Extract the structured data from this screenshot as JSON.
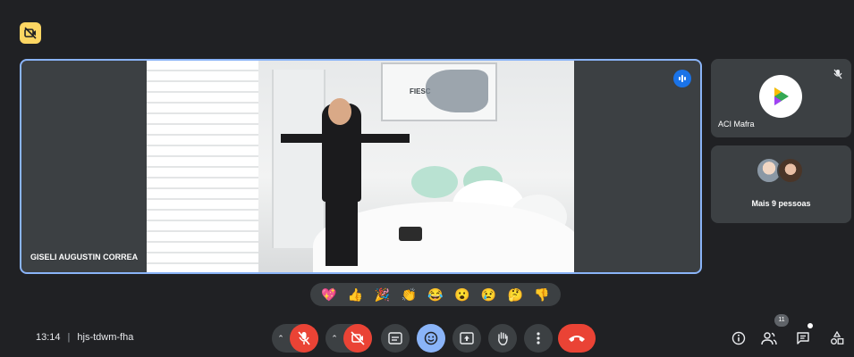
{
  "main_tile": {
    "participant_name": "GISELI AUGUSTIN CORREA",
    "map_title": "FIESC"
  },
  "side_tiles": [
    {
      "name": "ACI Mafra"
    },
    {
      "more_label": "Mais 9 pessoas"
    }
  ],
  "reactions": [
    "💖",
    "👍",
    "🎉",
    "👏",
    "😂",
    "😮",
    "😢",
    "🤔",
    "👎"
  ],
  "meeting": {
    "time": "13:14",
    "separator": "|",
    "code": "hjs-tdwm-fha"
  },
  "participants_count": "11",
  "colors": {
    "background": "#202124",
    "tile": "#3c4043",
    "active_border": "#8ab4f8",
    "danger": "#ea4335",
    "badge": "#fdd663",
    "speaking": "#1a73e8"
  },
  "icons": {
    "top_badge": "camera-off-icon",
    "mic": "mic-off-icon",
    "camera": "camera-off-icon",
    "captions": "captions-icon",
    "reactions": "emoji-icon",
    "present": "present-screen-icon",
    "raise_hand": "hand-icon",
    "more": "more-vert-icon",
    "leave": "phone-hangup-icon",
    "info": "info-icon",
    "people": "people-icon",
    "chat": "chat-icon",
    "activities": "activities-icon"
  }
}
